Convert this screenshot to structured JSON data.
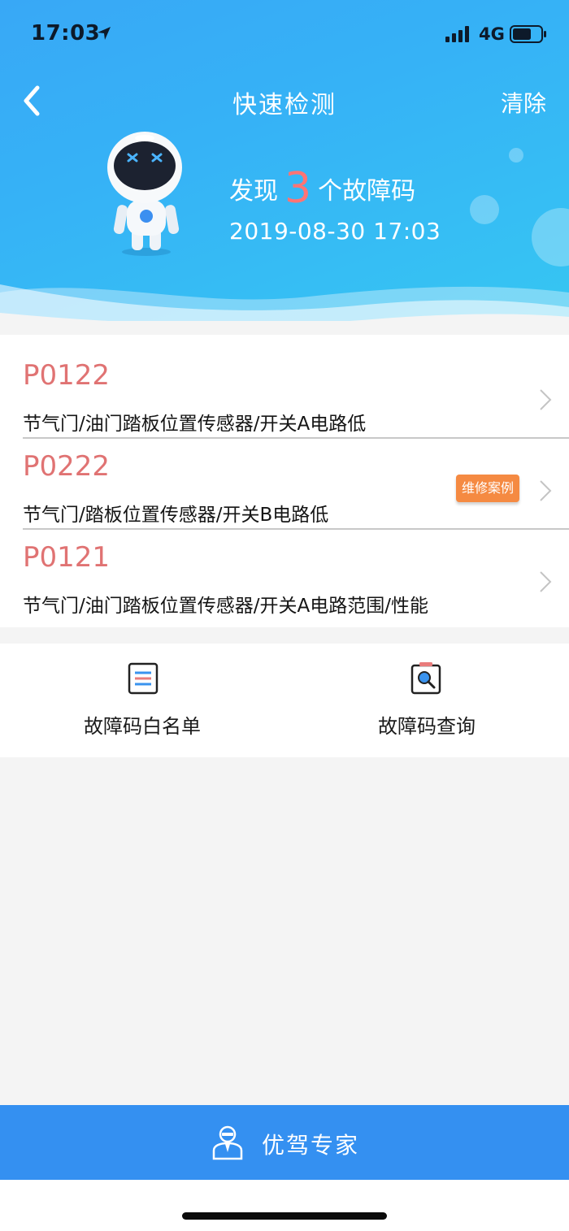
{
  "status_bar": {
    "time": "17:03",
    "network": "4G",
    "icons": [
      "location-arrow-icon",
      "signal-icon",
      "battery-icon"
    ]
  },
  "header": {
    "title": "快速检测",
    "clear_label": "清除",
    "back_icon": "chevron-left-icon",
    "summary_prefix": "发现",
    "fault_count": "3",
    "summary_suffix": "个故障码",
    "scan_time": "2019-08-30 17:03"
  },
  "faults": [
    {
      "code": "P0122",
      "description": "节气门/油门踏板位置传感器/开关A电路低",
      "badge": null
    },
    {
      "code": "P0222",
      "description": "节气门/踏板位置传感器/开关B电路低",
      "badge": "维修案例"
    },
    {
      "code": "P0121",
      "description": "节气门/油门踏板位置传感器/开关A电路范围/性能",
      "badge": null
    }
  ],
  "tools": {
    "whitelist": {
      "label": "故障码白名单",
      "icon": "list-icon"
    },
    "lookup": {
      "label": "故障码查询",
      "icon": "search-clipboard-icon"
    }
  },
  "expert_bar": {
    "label": "优驾专家",
    "icon": "expert-avatar-icon"
  },
  "colors": {
    "header_blue": "#38a8f6",
    "fault_code": "#e07373",
    "fault_count": "#ff7474",
    "badge_orange": "#f58a42",
    "expert_bar": "#3490f1"
  }
}
